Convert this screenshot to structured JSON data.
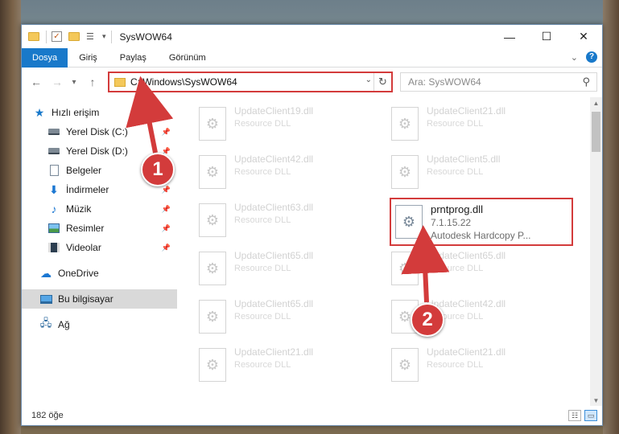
{
  "window": {
    "title": "SysWOW64",
    "controls": {
      "minimize": "—",
      "maximize": "☐",
      "close": "✕"
    }
  },
  "ribbon": {
    "tabs": [
      "Dosya",
      "Giriş",
      "Paylaş",
      "Görünüm"
    ],
    "help_label": "?"
  },
  "address": {
    "path": "C:\\Windows\\SysWOW64",
    "search_placeholder": "Ara: SysWOW64"
  },
  "nav": {
    "quick_access": "Hızlı erişim",
    "items": [
      {
        "label": "Yerel Disk (C:)",
        "icon": "disk-icon",
        "pinned": true
      },
      {
        "label": "Yerel Disk (D:)",
        "icon": "disk-icon",
        "pinned": true
      },
      {
        "label": "Belgeler",
        "icon": "document-icon",
        "pinned": true
      },
      {
        "label": "İndirmeler",
        "icon": "download-icon",
        "pinned": true
      },
      {
        "label": "Müzik",
        "icon": "music-icon",
        "pinned": true
      },
      {
        "label": "Resimler",
        "icon": "pictures-icon",
        "pinned": true
      },
      {
        "label": "Videolar",
        "icon": "video-icon",
        "pinned": true
      }
    ],
    "onedrive": "OneDrive",
    "this_pc": "Bu bilgisayar",
    "network": "Ağ"
  },
  "files": [
    {
      "name": "UpdateClient19.dll",
      "type": "Resource DLL"
    },
    {
      "name": "UpdateClient21.dll",
      "type": "Resource DLL"
    },
    {
      "name": "UpdateClient42.dll",
      "type": "Resource DLL"
    },
    {
      "name": "UpdateClient5.dll",
      "type": "Resource DLL"
    },
    {
      "name": "UpdateClient63.dll",
      "type": "Resource DLL"
    },
    {
      "name": "prntprog.dll",
      "version": "7.1.15.22",
      "company": "Autodesk Hardcopy P...",
      "highlighted": true
    },
    {
      "name": "UpdateClient65.dll",
      "type": "Resource DLL"
    },
    {
      "name": "UpdateClient65.dll",
      "type": "Resource DLL"
    },
    {
      "name": "UpdateClient65.dll",
      "type": "Resource DLL"
    },
    {
      "name": "UpdateClient42.dll",
      "type": "Resource DLL"
    },
    {
      "name": "UpdateClient21.dll",
      "type": "Resource DLL"
    },
    {
      "name": "UpdateClient21.dll",
      "type": "Resource DLL"
    }
  ],
  "status": {
    "count": "182 öğe"
  },
  "annotations": {
    "step1": "1",
    "step2": "2",
    "color": "#d33b3b"
  }
}
